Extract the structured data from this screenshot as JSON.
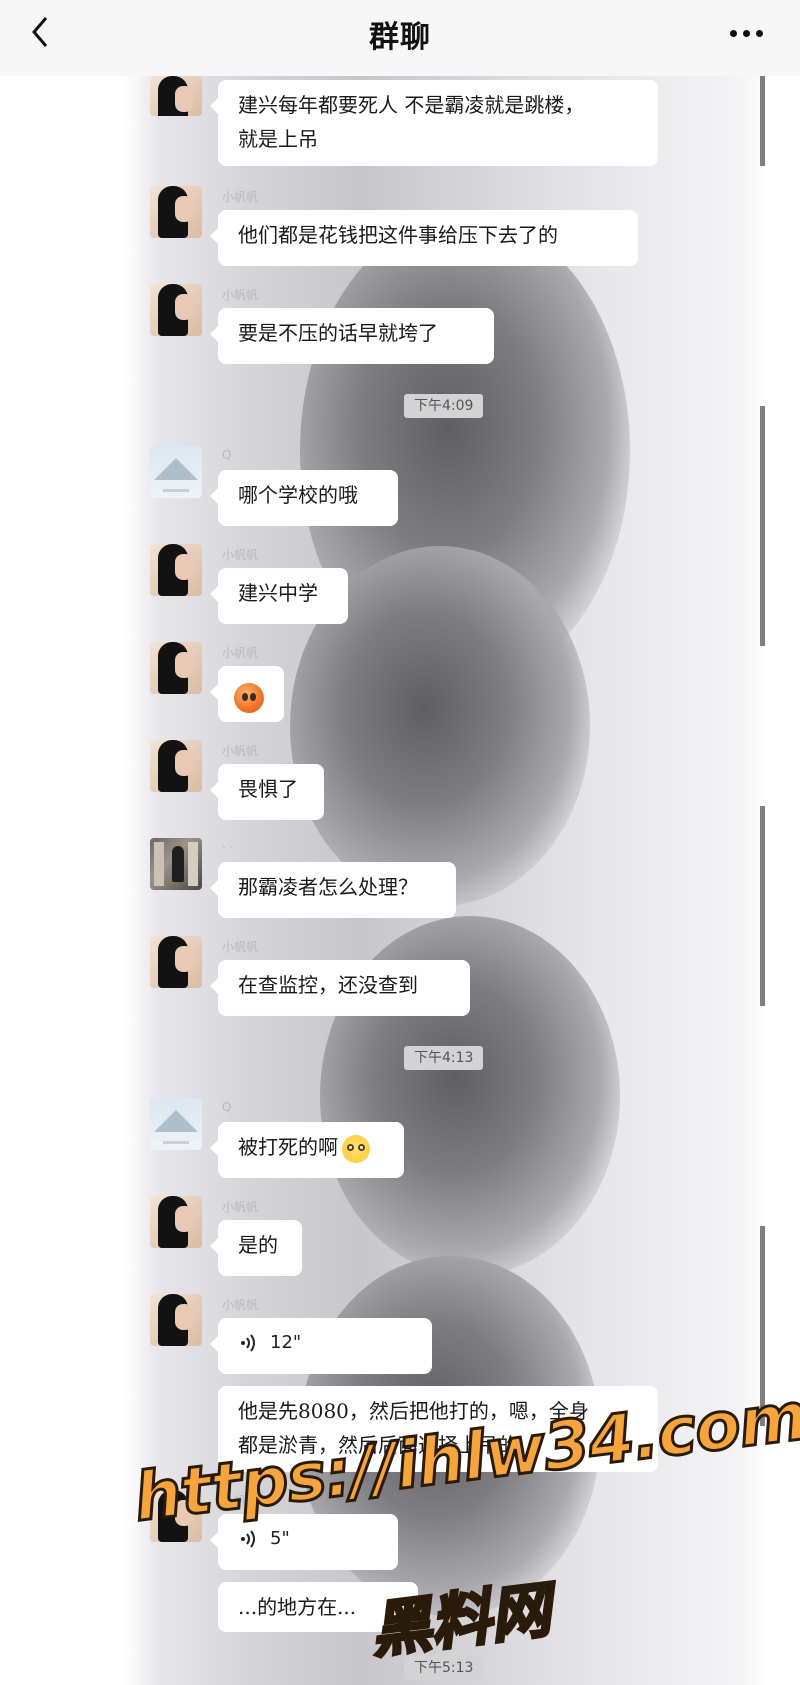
{
  "header": {
    "title": "群聊",
    "back_icon": "chevron-left-icon",
    "more_icon": "more-horizontal-icon"
  },
  "messages": [
    {
      "type": "text",
      "sender": "girl",
      "text": "建兴每年都要死人 不是霸凌就是跳楼，\n就是上吊"
    },
    {
      "type": "text",
      "sender": "girl",
      "nick": "小帆帆",
      "text": "他们都是花钱把这件事给压下去了的"
    },
    {
      "type": "text",
      "sender": "girl",
      "nick": "小帆帆",
      "text": "要是不压的话早就垮了"
    },
    {
      "type": "time",
      "text": "下午4:09"
    },
    {
      "type": "text",
      "sender": "scene",
      "nick": "Q",
      "text": "哪个学校的哦"
    },
    {
      "type": "text",
      "sender": "girl",
      "nick": "小帆帆",
      "text": "建兴中学"
    },
    {
      "type": "emoji",
      "sender": "girl",
      "nick": "小帆帆",
      "emoji": "scared-face-emoji"
    },
    {
      "type": "text",
      "sender": "girl",
      "nick": "小帆帆",
      "text": "畏惧了"
    },
    {
      "type": "text",
      "sender": "photo",
      "nick": "· ·",
      "text": "那霸凌者怎么处理？"
    },
    {
      "type": "text",
      "sender": "girl",
      "nick": "小帆帆",
      "text": "在查监控，还没查到"
    },
    {
      "type": "time",
      "text": "下午4:13"
    },
    {
      "type": "text",
      "sender": "scene",
      "nick": "Q",
      "text": "被打死的啊",
      "emoji": "flushed-face-emoji"
    },
    {
      "type": "text",
      "sender": "girl",
      "nick": "小帆帆",
      "text": "是的"
    },
    {
      "type": "voice",
      "sender": "girl",
      "nick": "小帆帆",
      "duration": "12\""
    },
    {
      "type": "text",
      "sender": "girl",
      "text": "他是先8080，然后把他打的，嗯，全身\n都是淤青，然后后面选择上吊的."
    },
    {
      "type": "voice",
      "sender": "girl",
      "nick": "小帆帆",
      "duration": "5\""
    },
    {
      "type": "text",
      "sender": "girl",
      "text": "...的地方在..."
    },
    {
      "type": "time",
      "text": "下午5:13"
    }
  ],
  "watermark": {
    "url": "https://ihlw34.com",
    "name": "黑料网"
  },
  "colors": {
    "nav_bg": "#f7f7f7",
    "bubble_bg": "#ffffff",
    "timestamp_bg": "#d3d3d6",
    "watermark_fill": "#f6a43c"
  }
}
